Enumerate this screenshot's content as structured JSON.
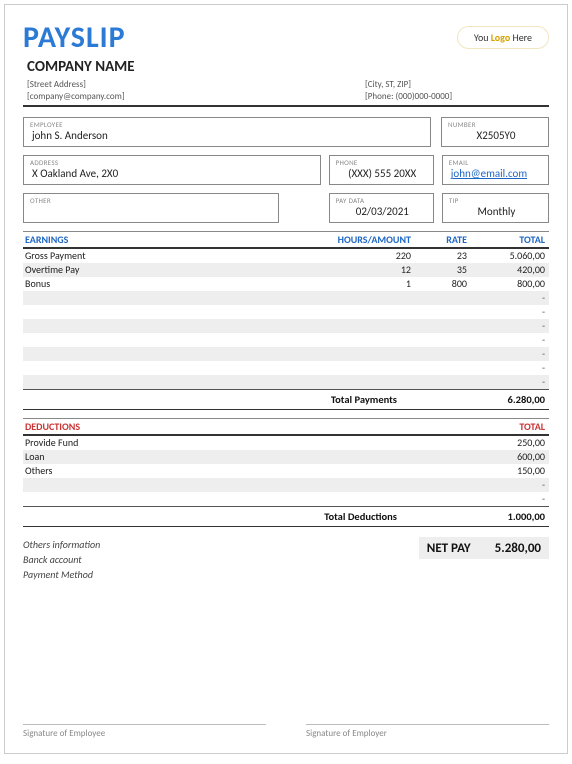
{
  "header": {
    "title": "PAYSLIP",
    "logo_pre": "You ",
    "logo_mid": "Logo",
    "logo_post": " Here",
    "company": "COMPANY NAME",
    "street": "[Street Address]",
    "email": "[company@company.com]",
    "city": "[City, ST, ZIP]",
    "phone": "[Phone: (000)000-0000]"
  },
  "info": {
    "employee_label": "EMPLOYEE",
    "employee": "john S. Anderson",
    "number_label": "NUMBER",
    "number": "X2505Y0",
    "address_label": "ADDRESS",
    "address": "X Oakland Ave, 2X0",
    "phone_label": "PHONE",
    "phone": "(XXX) 555 20XX",
    "email_label": "EMAIL",
    "email": "john@email.com ",
    "other_label": "OTHER",
    "other": "",
    "paydata_label": "PAY DATA",
    "paydata": "02/03/2021",
    "tip_label": "TIP",
    "tip": "Monthly"
  },
  "earnings": {
    "heading": "EARNINGS",
    "col_hours": "HOURS/AMOUNT",
    "col_rate": "RATE",
    "col_total": "TOTAL",
    "rows": [
      {
        "name": "Gross Payment",
        "hours": "220",
        "rate": "23",
        "total": "5.060,00"
      },
      {
        "name": "Overtime Pay",
        "hours": "12",
        "rate": "35",
        "total": "420,00"
      },
      {
        "name": "Bonus",
        "hours": "1",
        "rate": "800",
        "total": "800,00"
      },
      {
        "name": "",
        "hours": "",
        "rate": "",
        "total": "-"
      },
      {
        "name": "",
        "hours": "",
        "rate": "",
        "total": "-"
      },
      {
        "name": "",
        "hours": "",
        "rate": "",
        "total": "-"
      },
      {
        "name": "",
        "hours": "",
        "rate": "",
        "total": "-"
      },
      {
        "name": "",
        "hours": "",
        "rate": "",
        "total": "-"
      },
      {
        "name": "",
        "hours": "",
        "rate": "",
        "total": "-"
      },
      {
        "name": "",
        "hours": "",
        "rate": "",
        "total": "-"
      }
    ],
    "total_label": "Total Payments",
    "total_value": "6.280,00"
  },
  "deductions": {
    "heading": "DEDUCTIONS",
    "col_total": "TOTAL",
    "rows": [
      {
        "name": "Provide Fund",
        "total": "250,00"
      },
      {
        "name": "Loan",
        "total": "600,00"
      },
      {
        "name": "Others",
        "total": "150,00"
      },
      {
        "name": "",
        "total": "-"
      },
      {
        "name": "",
        "total": "-"
      }
    ],
    "total_label": "Total Deductions",
    "total_value": "1.000,00"
  },
  "footer": {
    "others_info": "Others information",
    "bank": "Banck account",
    "payment": "Payment Method",
    "netpay_label": "NET PAY",
    "netpay_value": "5.280,00",
    "sig_employee": "Signature of Employee",
    "sig_employer": "Signature of Employer"
  }
}
